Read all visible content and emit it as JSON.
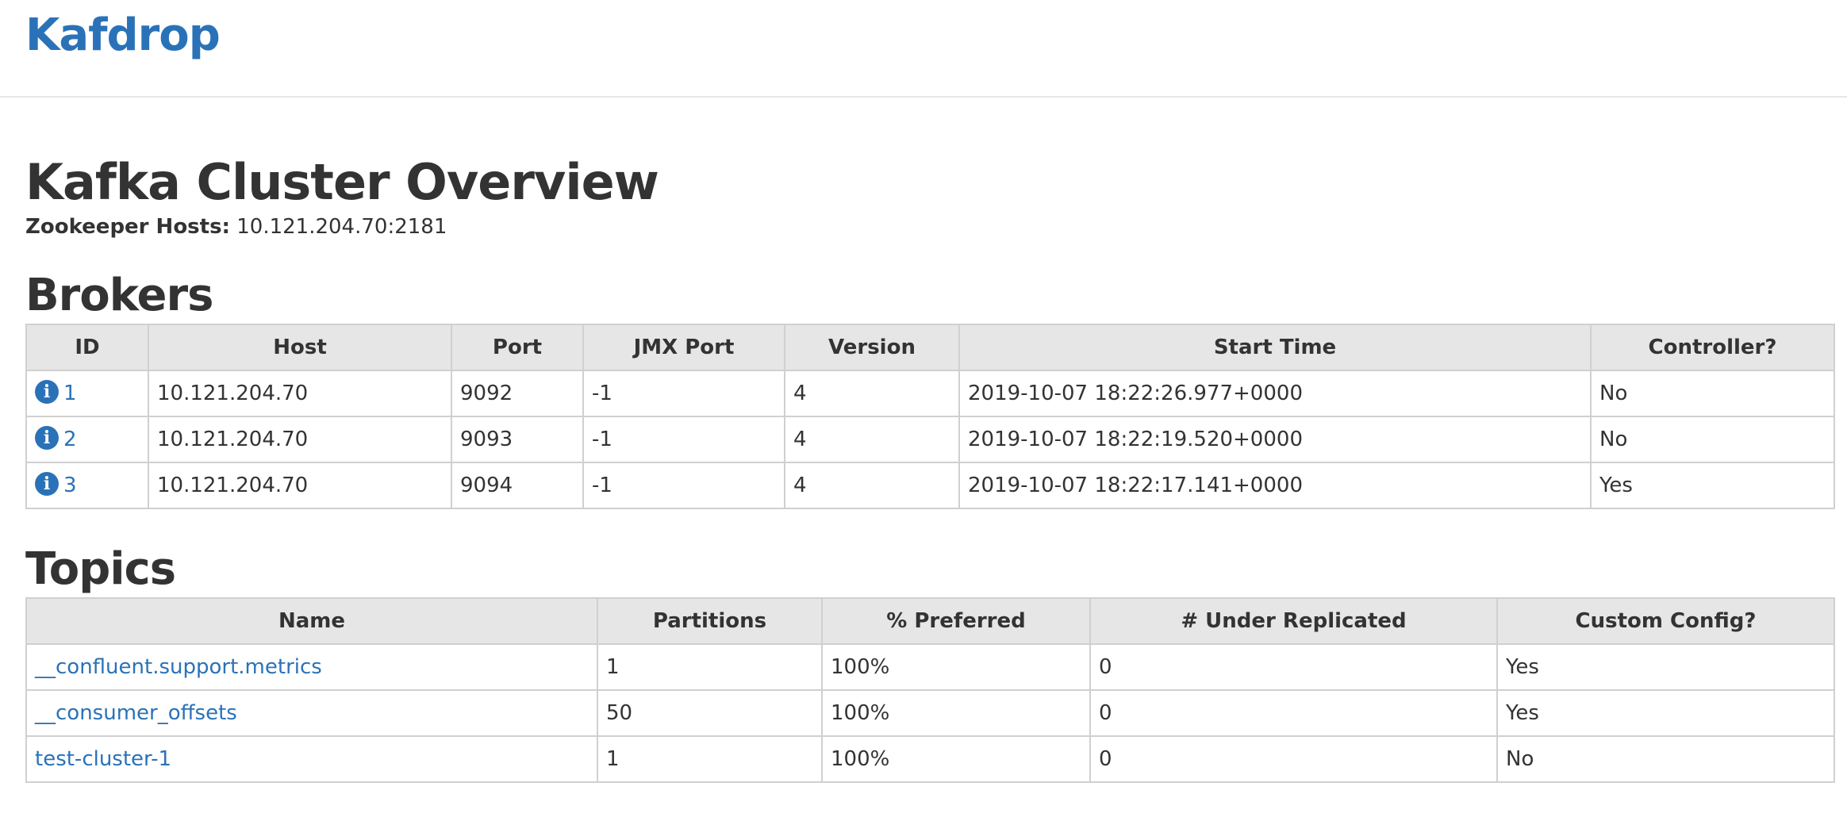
{
  "app": {
    "brand": "Kafdrop"
  },
  "overview": {
    "title": "Kafka Cluster Overview",
    "zookeeper_label": "Zookeeper Hosts:",
    "zookeeper_value": "10.121.204.70:2181"
  },
  "brokers": {
    "title": "Brokers",
    "headers": [
      "ID",
      "Host",
      "Port",
      "JMX Port",
      "Version",
      "Start Time",
      "Controller?"
    ],
    "rows": [
      {
        "id": "1",
        "host": "10.121.204.70",
        "port": "9092",
        "jmx_port": "-1",
        "version": "4",
        "start_time": "2019-10-07 18:22:26.977+0000",
        "controller": "No"
      },
      {
        "id": "2",
        "host": "10.121.204.70",
        "port": "9093",
        "jmx_port": "-1",
        "version": "4",
        "start_time": "2019-10-07 18:22:19.520+0000",
        "controller": "No"
      },
      {
        "id": "3",
        "host": "10.121.204.70",
        "port": "9094",
        "jmx_port": "-1",
        "version": "4",
        "start_time": "2019-10-07 18:22:17.141+0000",
        "controller": "Yes"
      }
    ],
    "icon": "info-icon"
  },
  "topics": {
    "title": "Topics",
    "headers": [
      "Name",
      "Partitions",
      "% Preferred",
      "# Under Replicated",
      "Custom Config?"
    ],
    "rows": [
      {
        "name": "__confluent.support.metrics",
        "partitions": "1",
        "preferred": "100%",
        "under_replicated": "0",
        "custom_config": "Yes"
      },
      {
        "name": "__consumer_offsets",
        "partitions": "50",
        "preferred": "100%",
        "under_replicated": "0",
        "custom_config": "Yes"
      },
      {
        "name": "test-cluster-1",
        "partitions": "1",
        "preferred": "100%",
        "under_replicated": "0",
        "custom_config": "No"
      }
    ]
  },
  "colors": {
    "link": "#2a72b8",
    "header_bg": "#e6e6e6",
    "border": "#d0d0d0",
    "text": "#333333"
  }
}
